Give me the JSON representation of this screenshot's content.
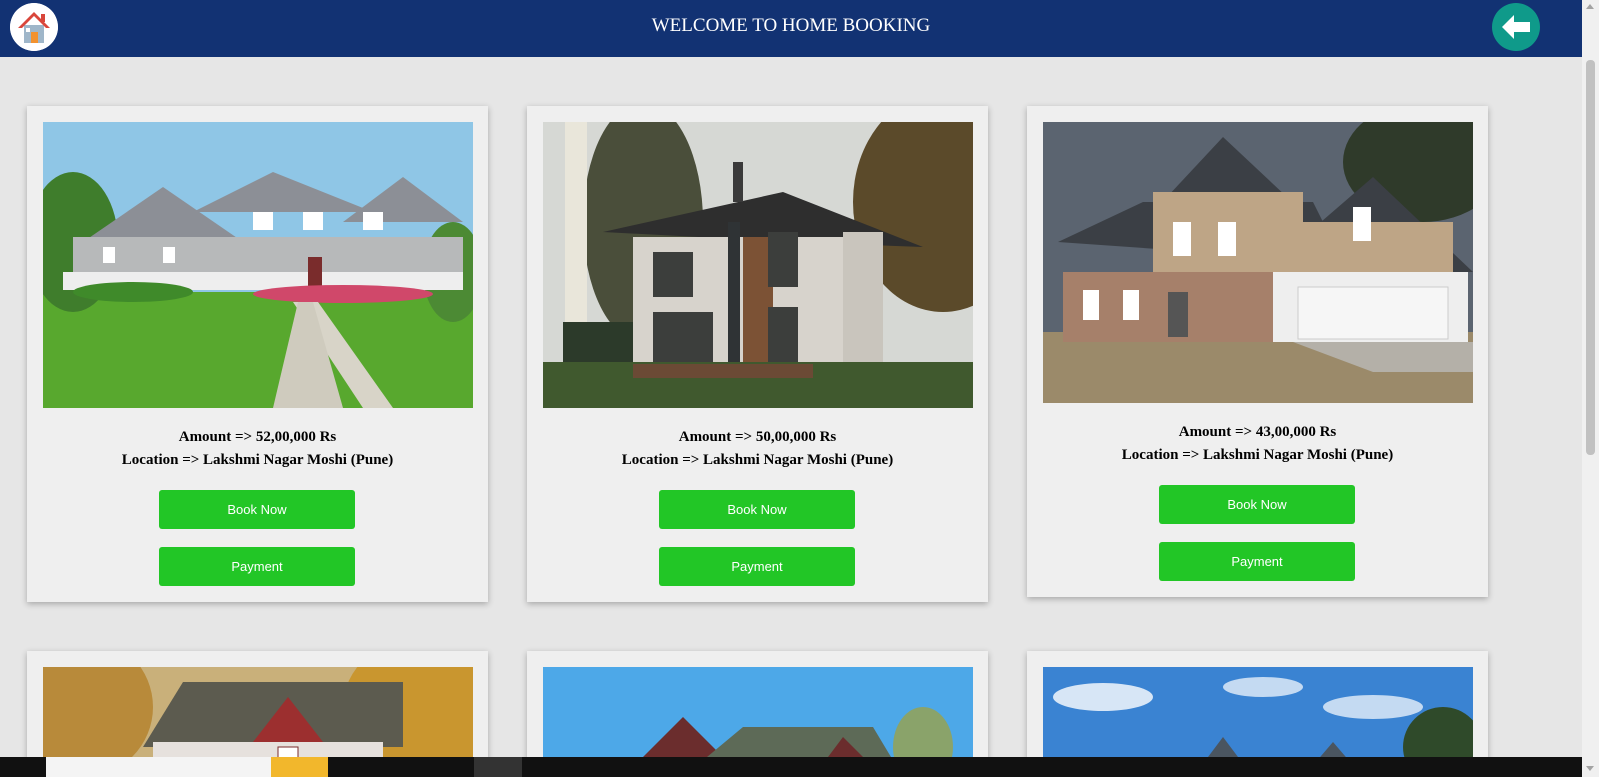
{
  "header": {
    "title": "WELCOME TO HOME BOOKING",
    "logo_icon": "home-icon",
    "back_icon": "arrow-left-icon"
  },
  "colors": {
    "header_bg": "#123273",
    "button_green": "#22c626",
    "back_button": "#0f9a8a",
    "page_bg": "#e6e6e6",
    "card_bg": "#efefef"
  },
  "listings": [
    {
      "amount": "Amount => 52,00,000 Rs",
      "location": "Location => Lakshmi Nagar Moshi (Pune)",
      "book_label": "Book Now",
      "payment_label": "Payment"
    },
    {
      "amount": "Amount => 50,00,000 Rs",
      "location": "Location => Lakshmi Nagar Moshi (Pune)",
      "book_label": "Book Now",
      "payment_label": "Payment"
    },
    {
      "amount": "Amount => 43,00,000 Rs",
      "location": "Location => Lakshmi Nagar Moshi (Pune)",
      "book_label": "Book Now",
      "payment_label": "Payment"
    }
  ]
}
